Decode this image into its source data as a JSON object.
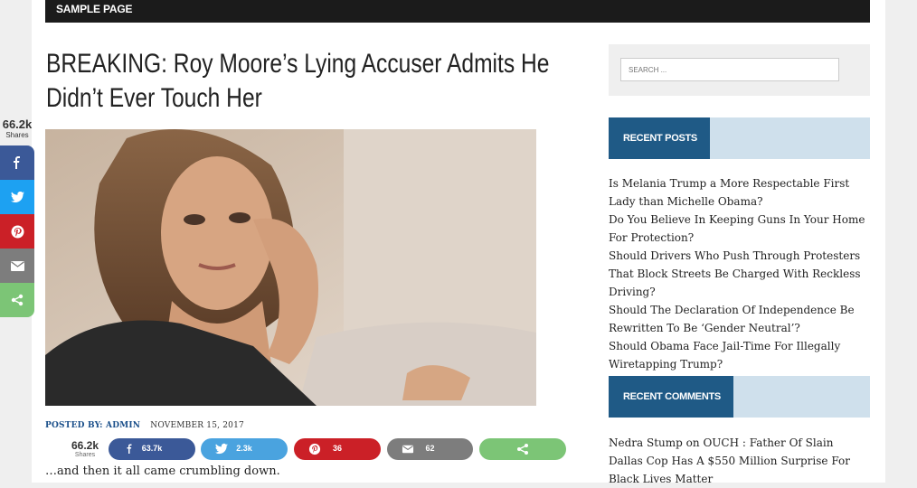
{
  "nav": {
    "item": "SAMPLE PAGE"
  },
  "article": {
    "title": "BREAKING: Roy Moore’s Lying Accuser Admits He Didn’t Ever Touch Her",
    "posted_by": "POSTED BY: ADMIN",
    "date": "NOVEMBER 15, 2017",
    "excerpt": "…and then it all came crumbling down."
  },
  "side_share": {
    "count": "66.2k",
    "count_label": "Shares",
    "buttons": [
      {
        "icon": "facebook-icon",
        "color": "#3b5998"
      },
      {
        "icon": "twitter-icon",
        "color": "#1da1f2"
      },
      {
        "icon": "pinterest-icon",
        "color": "#cb2027"
      },
      {
        "icon": "email-icon",
        "color": "#7d7d7d"
      },
      {
        "icon": "share-icon",
        "color": "#7cc576"
      }
    ]
  },
  "inline_share": {
    "count": "66.2k",
    "count_label": "Shares",
    "buttons": [
      {
        "icon": "facebook-icon",
        "count": "63.7k",
        "color": "#3b5998"
      },
      {
        "icon": "twitter-icon",
        "count": "2.3k",
        "color": "#4aa3df"
      },
      {
        "icon": "pinterest-icon",
        "count": "36",
        "color": "#cb2027"
      },
      {
        "icon": "email-icon",
        "count": "62",
        "color": "#7d7d7d"
      },
      {
        "icon": "share-icon",
        "count": "",
        "color": "#7cc576"
      }
    ]
  },
  "sidebar": {
    "search_placeholder": "SEARCH ...",
    "recent_posts_title": "RECENT POSTS",
    "recent_posts": [
      "Is Melania Trump a More Respectable First Lady than Michelle Obama?",
      "Do You Believe In Keeping Guns In Your Home For Protection?",
      "Should Drivers Who Push Through Protesters That Block Streets Be Charged With Reckless Driving?",
      "Should The Declaration Of Independence Be Rewritten To Be ‘Gender Neutral’?",
      "Should Obama Face Jail-Time For Illegally Wiretapping Trump?"
    ],
    "recent_comments_title": "RECENT COMMENTS",
    "comment": {
      "author": "Nedra Stump",
      "on": "on",
      "post": "OUCH : Father Of Slain Dallas Cop Has A $550 Million Surprise For Black Lives Matter"
    }
  },
  "colors": {
    "nav_bg": "#1b1b1b",
    "widget_label": "#1f5a86",
    "widget_band": "#cfe0ec",
    "link": "#1a4f8a"
  }
}
